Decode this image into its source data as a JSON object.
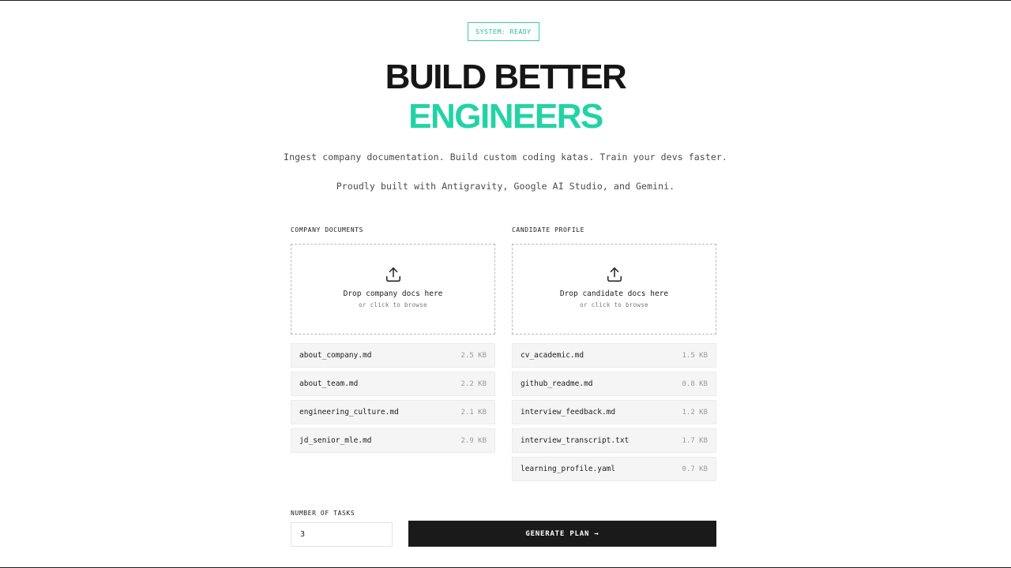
{
  "status": {
    "badge": "SYSTEM: READY"
  },
  "hero": {
    "line1": "BUILD BETTER",
    "line2": "ENGINEERS",
    "subtitle": "Ingest company documentation. Build custom coding katas. Train your devs faster.",
    "credits": "Proudly built with Antigravity, Google AI Studio, and Gemini."
  },
  "company": {
    "label": "COMPANY DOCUMENTS",
    "drop_title": "Drop company docs here",
    "drop_sub": "or click to browse",
    "upload_icon": "upload-icon",
    "files": [
      {
        "name": "about_company.md",
        "size": "2.5 KB"
      },
      {
        "name": "about_team.md",
        "size": "2.2 KB"
      },
      {
        "name": "engineering_culture.md",
        "size": "2.1 KB"
      },
      {
        "name": "jd_senior_mle.md",
        "size": "2.9 KB"
      }
    ]
  },
  "candidate": {
    "label": "CANDIDATE PROFILE",
    "drop_title": "Drop candidate docs here",
    "drop_sub": "or click to browse",
    "upload_icon": "upload-icon",
    "files": [
      {
        "name": "cv_academic.md",
        "size": "1.5 KB"
      },
      {
        "name": "github_readme.md",
        "size": "0.8 KB"
      },
      {
        "name": "interview_feedback.md",
        "size": "1.2 KB"
      },
      {
        "name": "interview_transcript.txt",
        "size": "1.7 KB"
      },
      {
        "name": "learning_profile.yaml",
        "size": "0.7 KB"
      }
    ]
  },
  "tasks": {
    "label": "NUMBER OF TASKS",
    "value": "3"
  },
  "actions": {
    "generate_label": "GENERATE PLAN →"
  },
  "colors": {
    "accent": "#22d3a6",
    "dark": "#1a1a1a"
  }
}
